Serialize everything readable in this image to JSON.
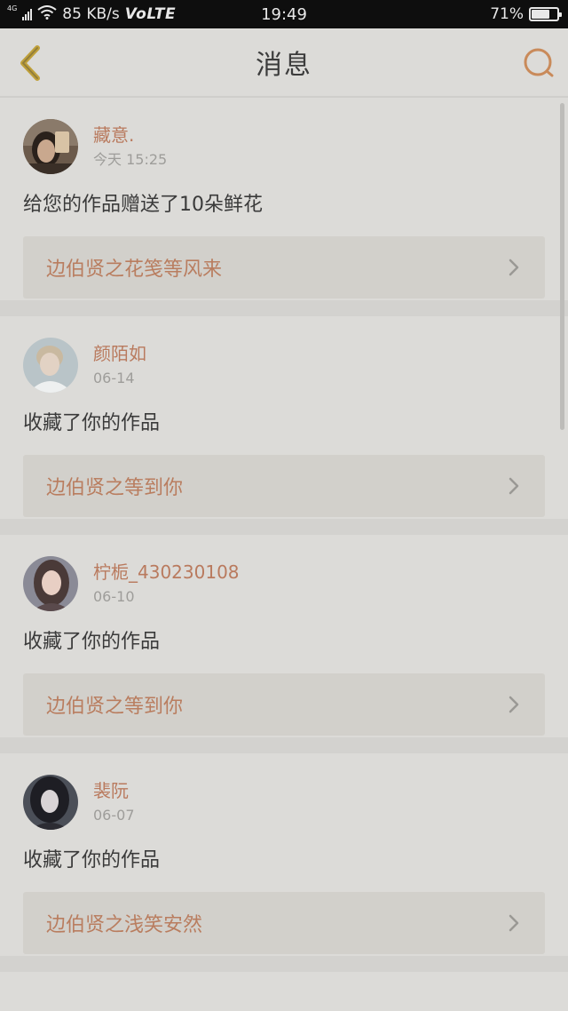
{
  "status_bar": {
    "network": "4G",
    "speed": "85 KB/s",
    "volte": "VoLTE",
    "time": "19:49",
    "battery_percent": "71%",
    "battery_level": 0.71
  },
  "header": {
    "title": "消息",
    "back_icon": "chevron-left-icon",
    "search_icon": "search-icon"
  },
  "messages": [
    {
      "username": "藏意.",
      "date": "今天 15:25",
      "action": "给您的作品赠送了10朵鲜花",
      "work_title": "边伯贤之花笺等风来"
    },
    {
      "username": "颜陌如",
      "date": "06-14",
      "action": "收藏了你的作品",
      "work_title": "边伯贤之等到你"
    },
    {
      "username": "柠栀_430230108",
      "date": "06-10",
      "action": "收藏了你的作品",
      "work_title": "边伯贤之等到你"
    },
    {
      "username": "裴阮",
      "date": "06-07",
      "action": "收藏了你的作品",
      "work_title": "边伯贤之浅笑安然"
    }
  ],
  "colors": {
    "accent": "#b97a5e",
    "back_icon": "#c9a227",
    "search_icon": "#c98a5a",
    "background": "#dcdbd8"
  }
}
